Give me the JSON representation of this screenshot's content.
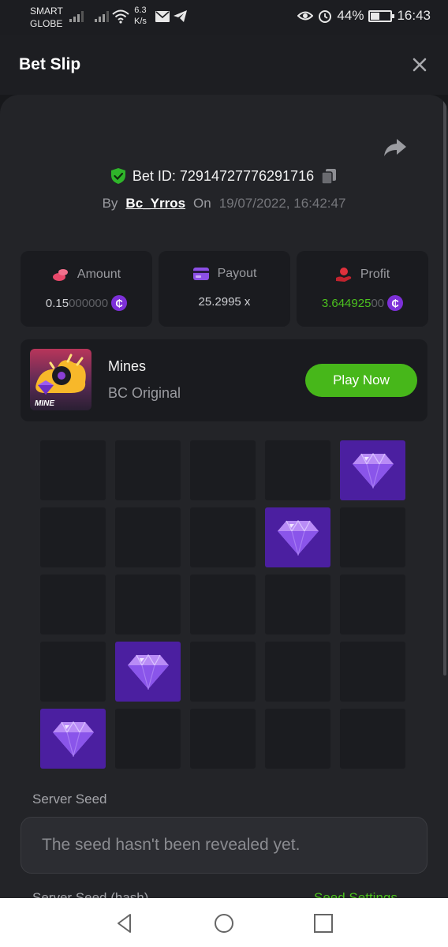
{
  "status_bar": {
    "carrier_line1": "SMART",
    "carrier_line2": "GLOBE",
    "speed_value": "6.3",
    "speed_unit": "K/s",
    "battery": "44%",
    "battery_level": 0.44,
    "time": "16:43",
    "icons": [
      "signal-icon",
      "wifi-icon",
      "mail-icon",
      "telegram-icon",
      "eye-icon",
      "alarm-icon",
      "battery-icon"
    ]
  },
  "header": {
    "title": "Bet Slip"
  },
  "bet": {
    "id_label": "Bet ID: 72914727776291716",
    "by_label": "By",
    "username": "Bc_Yrros",
    "on_label": "On",
    "datetime": "19/07/2022, 16:42:47"
  },
  "stats": {
    "amount": {
      "label": "Amount",
      "value_main": "0.15",
      "value_dim": "000000"
    },
    "payout": {
      "label": "Payout",
      "value": "25.2995 x"
    },
    "profit": {
      "label": "Profit",
      "value_main": "3.644925",
      "value_dim": "00"
    },
    "coin_symbol": "₵"
  },
  "game": {
    "name": "Mines",
    "subtitle": "BC Original",
    "thumb_label": "MINE",
    "play_label": "Play Now"
  },
  "board": {
    "rows": 5,
    "cols": 5,
    "gems": [
      [
        0,
        4
      ],
      [
        1,
        3
      ],
      [
        3,
        1
      ],
      [
        4,
        0
      ]
    ]
  },
  "server_seed": {
    "label": "Server Seed",
    "value": "The seed hasn't been revealed yet."
  },
  "next_section": {
    "label": "Server Seed (hash)",
    "link": "Seed Settings"
  },
  "colors": {
    "accent_green": "#47b71a",
    "gem_purple": "#4b1fa0",
    "coin_purple": "#7d30d8",
    "panel_bg": "#232428",
    "card_bg": "#1a1b1f"
  }
}
